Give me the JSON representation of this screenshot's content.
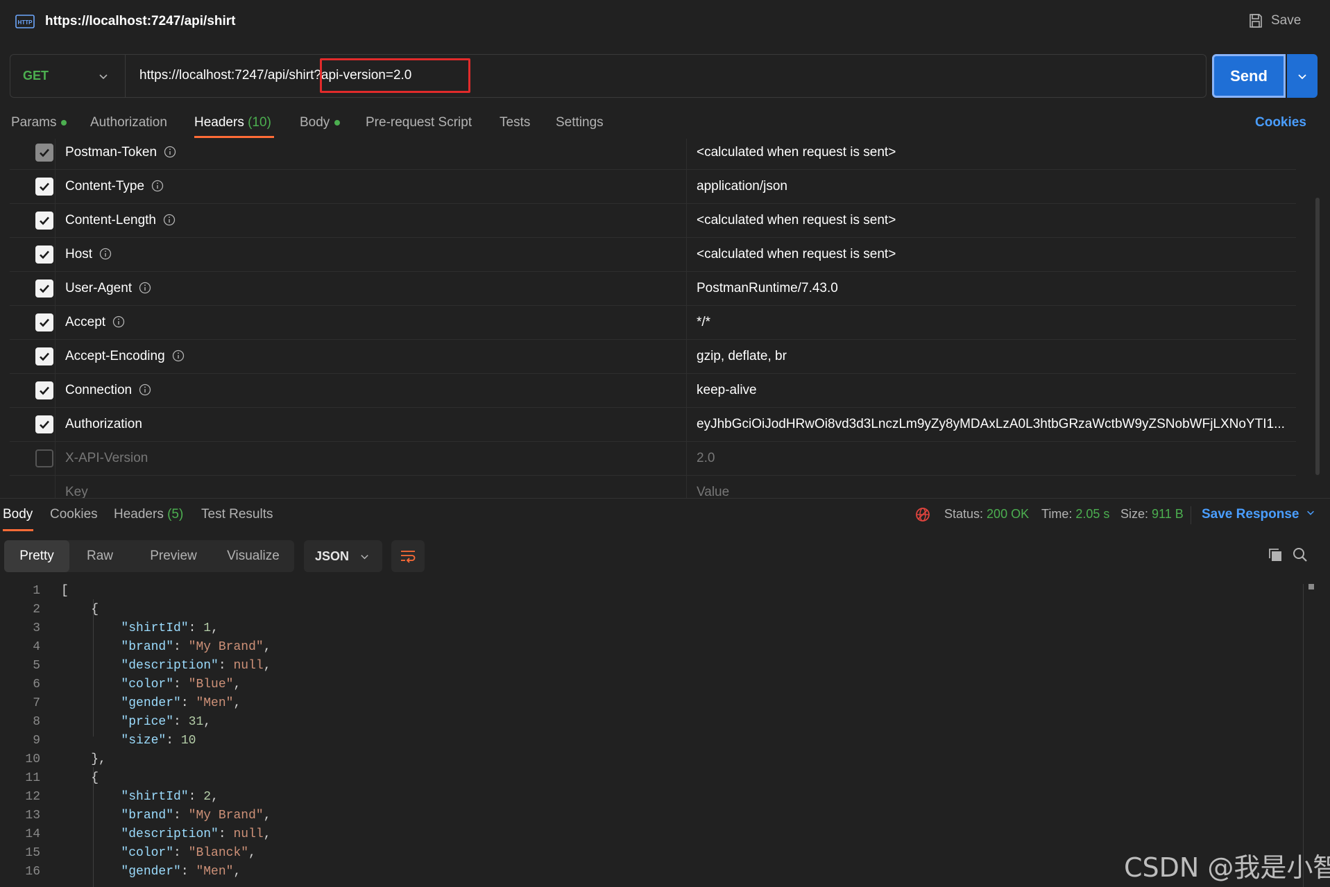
{
  "request": {
    "title": "https://localhost:7247/api/shirt",
    "save_label": "Save",
    "method": "GET",
    "url": "https://localhost:7247/api/shirt?api-version=2.0",
    "send_label": "Send"
  },
  "req_tabs": [
    {
      "label": "Params",
      "dot": true
    },
    {
      "label": "Authorization"
    },
    {
      "label": "Headers",
      "count": "(10)"
    },
    {
      "label": "Body",
      "dot": true
    },
    {
      "label": "Pre-request Script"
    },
    {
      "label": "Tests"
    },
    {
      "label": "Settings"
    }
  ],
  "cookies_label": "Cookies",
  "headers": [
    {
      "key": "Postman-Token",
      "value": "<calculated when request is sent>",
      "checked": "grey",
      "info": true
    },
    {
      "key": "Content-Type",
      "value": "application/json",
      "checked": "on",
      "info": true
    },
    {
      "key": "Content-Length",
      "value": "<calculated when request is sent>",
      "checked": "on",
      "info": true
    },
    {
      "key": "Host",
      "value": "<calculated when request is sent>",
      "checked": "on",
      "info": true
    },
    {
      "key": "User-Agent",
      "value": "PostmanRuntime/7.43.0",
      "checked": "on",
      "info": true
    },
    {
      "key": "Accept",
      "value": "*/*",
      "checked": "on",
      "info": true
    },
    {
      "key": "Accept-Encoding",
      "value": "gzip, deflate, br",
      "checked": "on",
      "info": true
    },
    {
      "key": "Connection",
      "value": "keep-alive",
      "checked": "on",
      "info": true
    },
    {
      "key": "Authorization",
      "value": "eyJhbGciOiJodHRwOi8vd3d3LnczLm9yZy8yMDAxLzA0L3htbGRzaWctbW9yZSNobWFjLXNoYTI1...",
      "checked": "on",
      "info": false
    },
    {
      "key": "X-API-Version",
      "value": "2.0",
      "checked": "off",
      "info": false,
      "dim": true
    },
    {
      "key": "Key",
      "value": "Value",
      "checked": "none",
      "info": false,
      "dim": true
    }
  ],
  "response": {
    "tabs": [
      {
        "label": "Body"
      },
      {
        "label": "Cookies"
      },
      {
        "label": "Headers",
        "count": "(5)"
      },
      {
        "label": "Test Results"
      }
    ],
    "status_label": "Status:",
    "status_value": "200 OK",
    "time_label": "Time:",
    "time_value": "2.05 s",
    "size_label": "Size:",
    "size_value": "911 B",
    "save_response_label": "Save Response",
    "format_buttons": [
      "Pretty",
      "Raw",
      "Preview",
      "Visualize"
    ],
    "format_selected": "JSON"
  },
  "code_lines": [
    [
      [
        "p",
        "["
      ]
    ],
    [
      [
        "p",
        "    {"
      ]
    ],
    [
      [
        "p",
        "        "
      ],
      [
        "k",
        "\"shirtId\""
      ],
      [
        "p",
        ": "
      ],
      [
        "n",
        "1"
      ],
      [
        "p",
        ","
      ]
    ],
    [
      [
        "p",
        "        "
      ],
      [
        "k",
        "\"brand\""
      ],
      [
        "p",
        ": "
      ],
      [
        "s",
        "\"My Brand\""
      ],
      [
        "p",
        ","
      ]
    ],
    [
      [
        "p",
        "        "
      ],
      [
        "k",
        "\"description\""
      ],
      [
        "p",
        ": "
      ],
      [
        "nl",
        "null"
      ],
      [
        "p",
        ","
      ]
    ],
    [
      [
        "p",
        "        "
      ],
      [
        "k",
        "\"color\""
      ],
      [
        "p",
        ": "
      ],
      [
        "s",
        "\"Blue\""
      ],
      [
        "p",
        ","
      ]
    ],
    [
      [
        "p",
        "        "
      ],
      [
        "k",
        "\"gender\""
      ],
      [
        "p",
        ": "
      ],
      [
        "s",
        "\"Men\""
      ],
      [
        "p",
        ","
      ]
    ],
    [
      [
        "p",
        "        "
      ],
      [
        "k",
        "\"price\""
      ],
      [
        "p",
        ": "
      ],
      [
        "n",
        "31"
      ],
      [
        "p",
        ","
      ]
    ],
    [
      [
        "p",
        "        "
      ],
      [
        "k",
        "\"size\""
      ],
      [
        "p",
        ": "
      ],
      [
        "n",
        "10"
      ]
    ],
    [
      [
        "p",
        "    },"
      ]
    ],
    [
      [
        "p",
        "    {"
      ]
    ],
    [
      [
        "p",
        "        "
      ],
      [
        "k",
        "\"shirtId\""
      ],
      [
        "p",
        ": "
      ],
      [
        "n",
        "2"
      ],
      [
        "p",
        ","
      ]
    ],
    [
      [
        "p",
        "        "
      ],
      [
        "k",
        "\"brand\""
      ],
      [
        "p",
        ": "
      ],
      [
        "s",
        "\"My Brand\""
      ],
      [
        "p",
        ","
      ]
    ],
    [
      [
        "p",
        "        "
      ],
      [
        "k",
        "\"description\""
      ],
      [
        "p",
        ": "
      ],
      [
        "nl",
        "null"
      ],
      [
        "p",
        ","
      ]
    ],
    [
      [
        "p",
        "        "
      ],
      [
        "k",
        "\"color\""
      ],
      [
        "p",
        ": "
      ],
      [
        "s",
        "\"Blanck\""
      ],
      [
        "p",
        ","
      ]
    ],
    [
      [
        "p",
        "        "
      ],
      [
        "k",
        "\"gender\""
      ],
      [
        "p",
        ": "
      ],
      [
        "s",
        "\"Men\""
      ],
      [
        "p",
        ","
      ]
    ]
  ],
  "watermark": "CSDN @我是小智"
}
